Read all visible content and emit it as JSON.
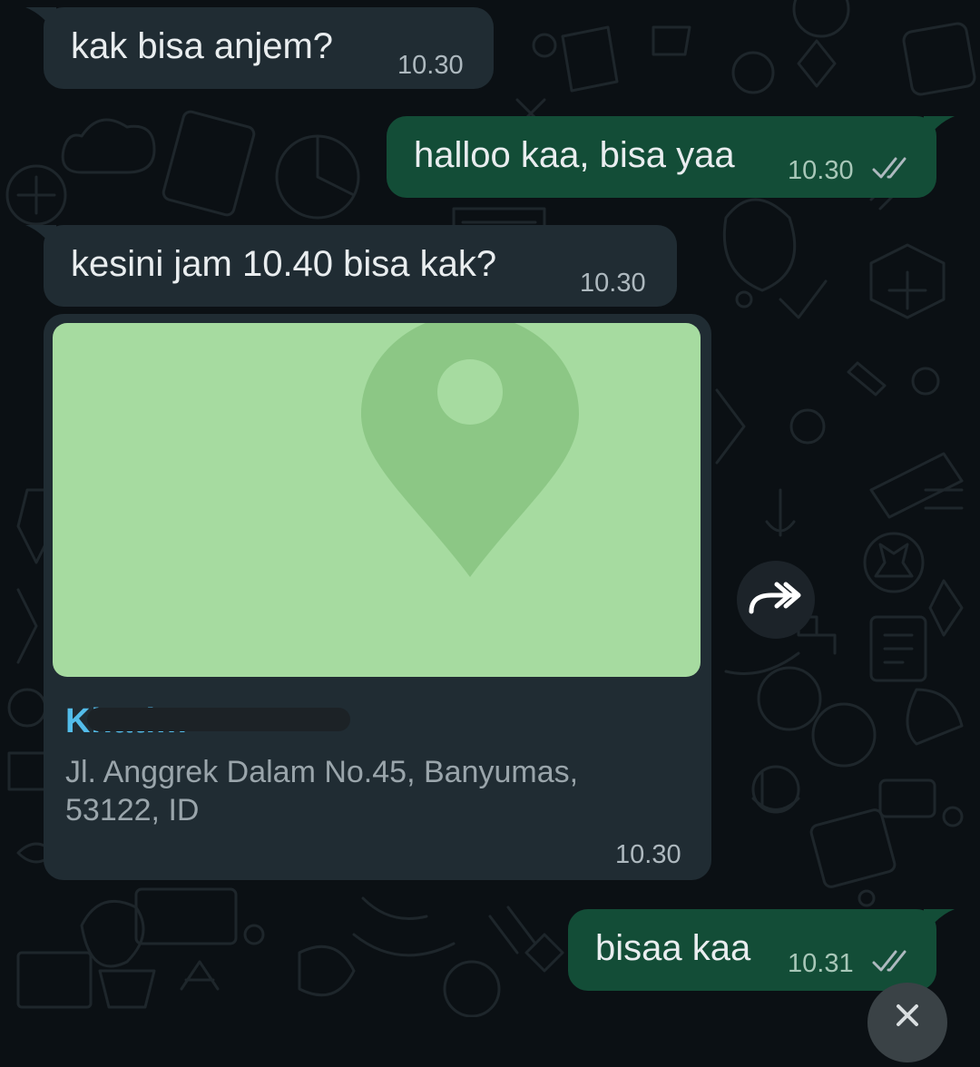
{
  "messages": [
    {
      "direction": "incoming",
      "text": "kak bisa anjem?",
      "time": "10.30"
    },
    {
      "direction": "outgoing",
      "text": "halloo kaa, bisa yaa",
      "time": "10.30",
      "status": "read"
    },
    {
      "direction": "incoming",
      "text": "kesini jam 10.40 bisa kak?",
      "time": "10.30"
    },
    {
      "direction": "incoming",
      "type": "location",
      "name": "Khatim",
      "address": "Jl. Anggrek Dalam No.45, Banyumas, 53122, ID",
      "time": "10.30"
    },
    {
      "direction": "outgoing",
      "text": "bisaa kaa",
      "time": "10.31",
      "status": "read"
    }
  ],
  "icons": {
    "forward": "forward-icon",
    "close": "close-icon",
    "map_pin": "map-pin-icon",
    "read_receipt": "double-check-icon"
  },
  "colors": {
    "background": "#0b1014",
    "incoming_bubble": "#202c33",
    "outgoing_bubble": "#134d37",
    "map_fill": "#a6dba0",
    "map_pin": "#8cc785",
    "location_name": "#53bdeb",
    "read_tick": "#aeb9bf"
  }
}
